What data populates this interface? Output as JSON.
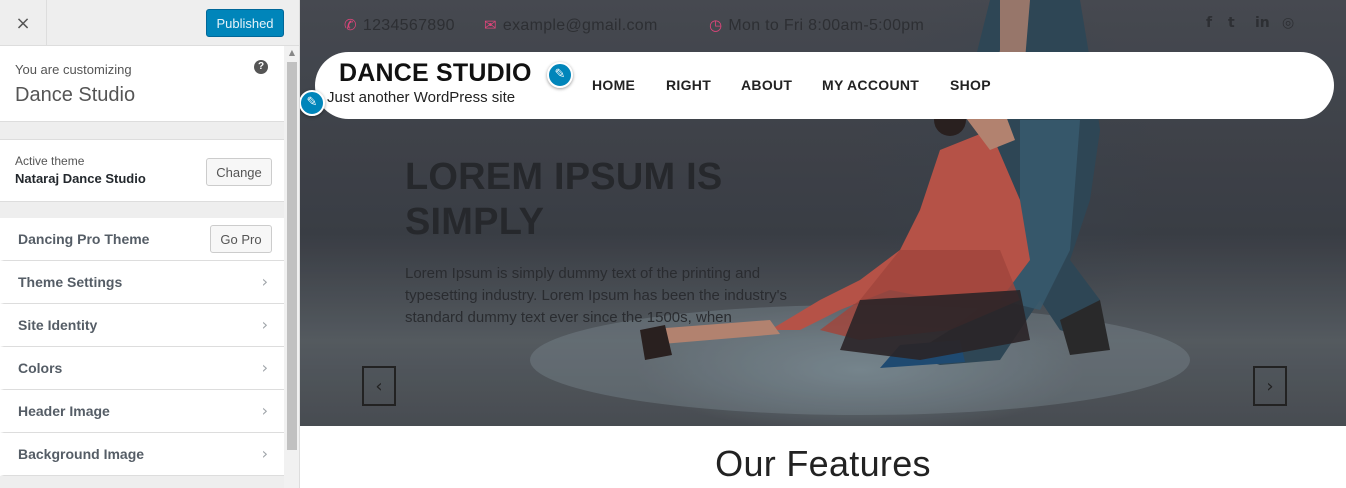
{
  "sidebar": {
    "close_icon": "×",
    "publish_label": "Published",
    "customizing_small": "You are customizing",
    "customizing_title": "Dance Studio",
    "help_icon": "?",
    "active_theme_small": "Active theme",
    "active_theme_name": "Nataraj Dance Studio",
    "change_label": "Change",
    "scroll_up_icon": "▲",
    "sections": [
      {
        "label": "Dancing Pro Theme",
        "button": "Go Pro"
      },
      {
        "label": "Theme Settings"
      },
      {
        "label": "Site Identity"
      },
      {
        "label": "Colors"
      },
      {
        "label": "Header Image"
      },
      {
        "label": "Background Image"
      }
    ],
    "chevron": "›"
  },
  "preview": {
    "topbar": {
      "phone_icon": "✆",
      "phone": "1234567890",
      "email_icon": "✉",
      "email": "example@gmail.com",
      "clock_icon": "◷",
      "hours": "Mon to Fri 8:00am-5:00pm",
      "social": [
        "f",
        "t",
        "in",
        "◎"
      ]
    },
    "site_title": "DANCE STUDIO",
    "tagline": "Just another WordPress site",
    "pencil_icon": "✎",
    "nav": [
      "HOME",
      "RIGHT",
      "ABOUT",
      "MY ACCOUNT",
      "SHOP"
    ],
    "hero": {
      "heading": "LOREM IPSUM IS SIMPLY",
      "text": "Lorem Ipsum is simply dummy text of the printing and typesetting industry. Lorem Ipsum has been the industry's standard dummy text ever since the 1500s, when",
      "prev_icon": "‹",
      "next_icon": "›"
    },
    "features_title": "Our Features"
  },
  "colors": {
    "publish_blue": "#0085ba",
    "accent_pink": "#e0457b"
  }
}
